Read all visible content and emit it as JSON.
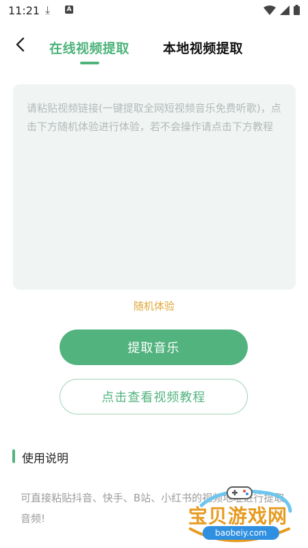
{
  "status_bar": {
    "time": "11:21",
    "download_icon": "download-icon",
    "a_badge": "A",
    "icons": [
      "wifi-icon",
      "signal-icon",
      "battery-icon"
    ]
  },
  "nav": {
    "back_icon": "chevron-left-icon",
    "tab_online": "在线视频提取",
    "tab_local": "本地视频提取",
    "accent_color": "#4db37a"
  },
  "input": {
    "placeholder": "请粘贴视频链接(一键提取全网短视频音乐免费听歌)，点击下方随机体验进行体验，若不会操作请点击下方教程"
  },
  "random_label": "随机体验",
  "buttons": {
    "extract": "提取音乐",
    "tutorial": "点击查看视频教程"
  },
  "usage": {
    "title": "使用说明",
    "text": "可直接粘贴抖音、快手、B站、小红书的视频地址进行提取音频!"
  },
  "watermark": {
    "main": "宝贝游戏网",
    "url": "baobeiy.com"
  },
  "colors": {
    "primary": "#52b37e",
    "random": "#e0a83a",
    "input_bg": "#f0f5f4"
  }
}
